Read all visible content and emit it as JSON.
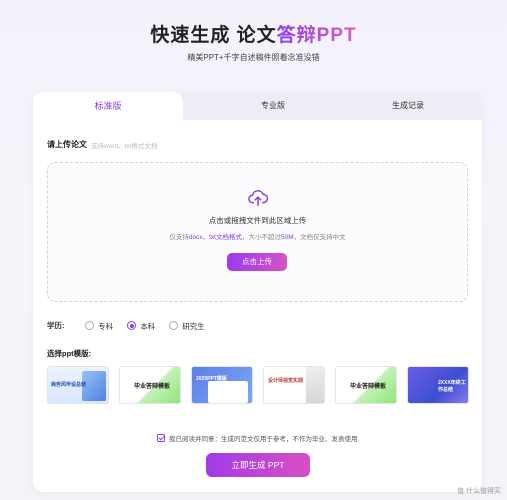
{
  "hero": {
    "title_prefix": "快速生成 论文",
    "title_accent": "答辩PPT",
    "subtitle": "精美PPT+千字自述稿件照着念准没错"
  },
  "tabs": [
    {
      "label": "标准版",
      "active": true
    },
    {
      "label": "专业版",
      "active": false
    },
    {
      "label": "生成记录",
      "active": false
    }
  ],
  "upload": {
    "label": "请上传论文",
    "hint": "支持word、txt格式文档",
    "drop_title": "点击或拖拽文件到此区域上传",
    "info_prefix": "仅支持",
    "info_formats": "docx、txt文档格式",
    "info_mid": "，大小不超过",
    "info_size": "50M",
    "info_suffix": "，文档仅支持中文",
    "button": "点击上传"
  },
  "education": {
    "label": "学历:",
    "options": [
      {
        "label": "专科",
        "checked": false
      },
      {
        "label": "本科",
        "checked": true
      },
      {
        "label": "研究生",
        "checked": false
      }
    ]
  },
  "templates": {
    "label": "选择ppt模版:",
    "items": [
      {
        "title": "商务风毕设总结"
      },
      {
        "title": "毕业答辩模板"
      },
      {
        "title": "2025PPT模版"
      },
      {
        "title": "设计师视觉实践"
      },
      {
        "title": "毕业答辩模板"
      },
      {
        "title": "2XXX年终工作总结"
      }
    ]
  },
  "agreement": {
    "checked": true,
    "text": "我已阅读并同意：生成的范文仅用于参考，不作为毕业、发表使用"
  },
  "generate_button": "立即生成 PPT",
  "watermark": "值 什么值得买",
  "colors": {
    "accent": "#8a3fe6",
    "button_gradient_start": "#a03be8",
    "button_gradient_end": "#d94fc2"
  }
}
